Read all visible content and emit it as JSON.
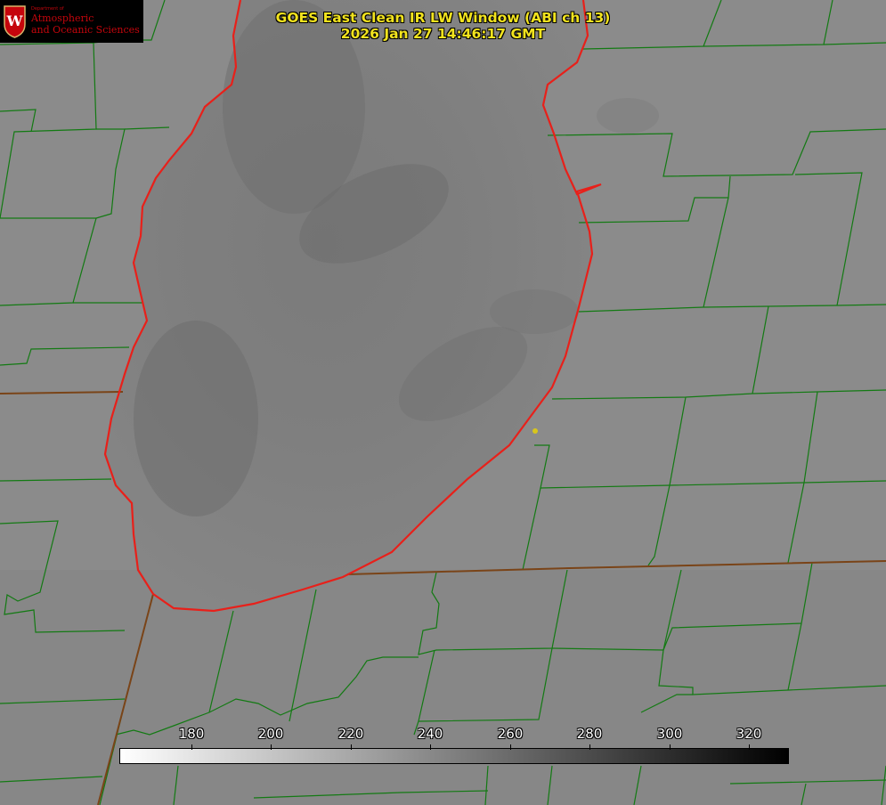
{
  "header": {
    "title_line1": "GOES East Clean IR LW Window (ABI ch 13)",
    "title_line2": "2026 Jan 27 14:46:17 GMT"
  },
  "logo": {
    "dept": "Department of",
    "line1": "Atmospheric",
    "line2": "and Oceanic Sciences"
  },
  "colorbar": {
    "ticks": [
      "180",
      "200",
      "220",
      "240",
      "260",
      "280",
      "300",
      "320"
    ],
    "colors": {
      "start": "#ffffff",
      "end": "#000000"
    }
  },
  "colors": {
    "county_lines": "#137a13",
    "lake_shore": "#e8201a",
    "state_lines": "#7a4418",
    "title": "#f2e31e",
    "marker": "#d8c61c"
  }
}
